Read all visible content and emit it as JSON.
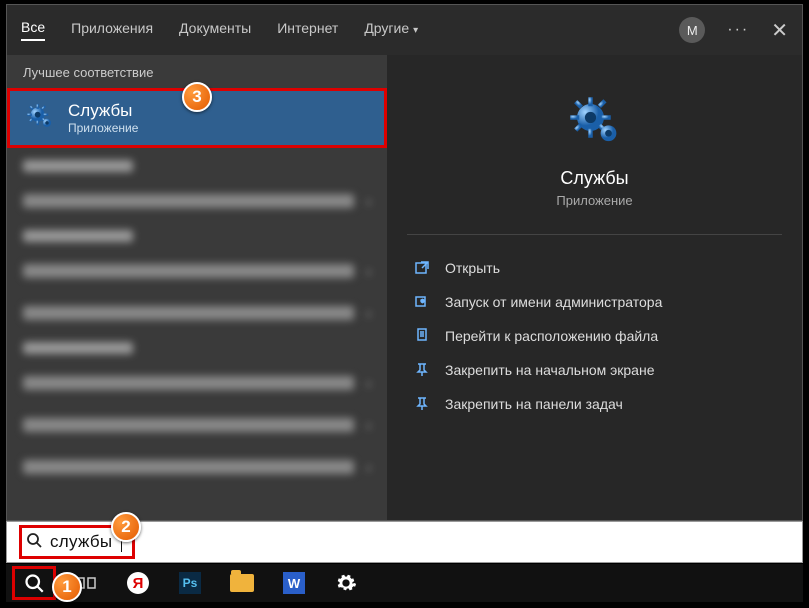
{
  "tabs": {
    "all": "Все",
    "apps": "Приложения",
    "docs": "Документы",
    "internet": "Интернет",
    "other": "Другие"
  },
  "avatar_letter": "M",
  "left": {
    "best_match_label": "Лучшее соответствие",
    "best": {
      "title": "Службы",
      "subtitle": "Приложение"
    }
  },
  "right": {
    "title": "Службы",
    "subtitle": "Приложение",
    "actions": {
      "open": "Открыть",
      "run_admin": "Запуск от имени администратора",
      "open_location": "Перейти к расположению файла",
      "pin_start": "Закрепить на начальном экране",
      "pin_taskbar": "Закрепить на панели задач"
    }
  },
  "search": {
    "query": "службы"
  },
  "badges": {
    "b1": "1",
    "b2": "2",
    "b3": "3"
  }
}
